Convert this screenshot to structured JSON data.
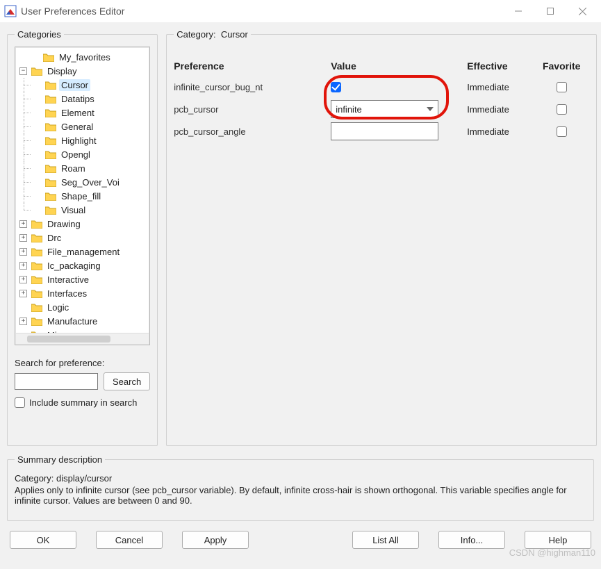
{
  "window": {
    "title": "User Preferences Editor"
  },
  "categories": {
    "legend": "Categories",
    "tree": {
      "my_favorites": "My_favorites",
      "display": {
        "label": "Display",
        "children": {
          "cursor": "Cursor",
          "datatips": "Datatips",
          "element": "Element",
          "general": "General",
          "highlight": "Highlight",
          "opengl": "Opengl",
          "roam": "Roam",
          "seg_over_voi": "Seg_Over_Voi",
          "shape_fill": "Shape_fill",
          "visual": "Visual"
        }
      },
      "drawing": "Drawing",
      "drc": "Drc",
      "file_management": "File_management",
      "ic_packaging": "Ic_packaging",
      "interactive": "Interactive",
      "interfaces": "Interfaces",
      "logic": "Logic",
      "manufacture": "Manufacture",
      "misc": "Misc"
    },
    "selected_path": "Cursor"
  },
  "search": {
    "label": "Search for preference:",
    "value": "",
    "button": "Search",
    "include_label": "Include summary in search",
    "include_checked": false
  },
  "category_panel": {
    "legend_prefix": "Category:",
    "legend_value": "Cursor",
    "columns": {
      "preference": "Preference",
      "value": "Value",
      "effective": "Effective",
      "favorite": "Favorite"
    },
    "rows": [
      {
        "name": "infinite_cursor_bug_nt",
        "value_type": "checkbox",
        "value_checked": true,
        "effective": "Immediate",
        "favorite": false
      },
      {
        "name": "pcb_cursor",
        "value_type": "select",
        "value_text": "infinite",
        "effective": "Immediate",
        "favorite": false
      },
      {
        "name": "pcb_cursor_angle",
        "value_type": "text",
        "value_text": "",
        "effective": "Immediate",
        "favorite": false
      }
    ]
  },
  "summary": {
    "legend": "Summary description",
    "category_line": "Category: display/cursor",
    "body": "Applies only to infinite cursor (see pcb_cursor variable). By default, infinite cross-hair is shown orthogonal. This variable specifies angle for infinite cursor. Values are between 0  and 90."
  },
  "buttons": {
    "ok": "OK",
    "cancel": "Cancel",
    "apply": "Apply",
    "list_all": "List All",
    "info": "Info...",
    "help": "Help"
  },
  "watermark": "CSDN @highman110"
}
